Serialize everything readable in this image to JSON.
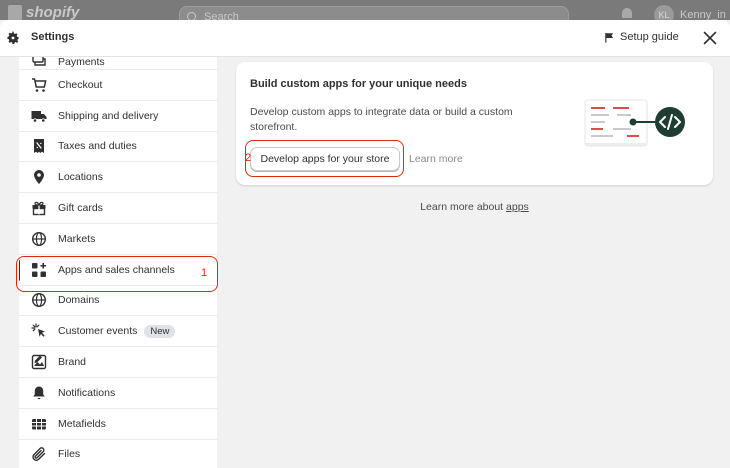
{
  "admin_bar": {
    "logo_text": "shopify",
    "search_placeholder": "Search",
    "user_initials": "KL",
    "user_name": "Kenny_in"
  },
  "header": {
    "title": "Settings",
    "setup_guide": "Setup guide"
  },
  "sidebar": {
    "items": [
      {
        "label": "Payments",
        "icon": "payments-icon"
      },
      {
        "label": "Checkout",
        "icon": "cart-icon"
      },
      {
        "label": "Shipping and delivery",
        "icon": "truck-icon"
      },
      {
        "label": "Taxes and duties",
        "icon": "receipt-icon"
      },
      {
        "label": "Locations",
        "icon": "location-pin-icon"
      },
      {
        "label": "Gift cards",
        "icon": "gift-icon"
      },
      {
        "label": "Markets",
        "icon": "globe-icon"
      },
      {
        "label": "Apps and sales channels",
        "icon": "apps-icon"
      },
      {
        "label": "Domains",
        "icon": "globe-icon"
      },
      {
        "label": "Customer events",
        "icon": "cursor-icon",
        "badge": "New"
      },
      {
        "label": "Brand",
        "icon": "brand-icon"
      },
      {
        "label": "Notifications",
        "icon": "bell-icon"
      },
      {
        "label": "Metafields",
        "icon": "metafields-icon"
      },
      {
        "label": "Files",
        "icon": "paperclip-icon"
      }
    ]
  },
  "main": {
    "card_title": "Build custom apps for your unique needs",
    "card_description": "Develop custom apps to integrate data or build a custom storefront.",
    "develop_button": "Develop apps for your store",
    "learn_more": "Learn more",
    "footer_prefix": "Learn more about",
    "footer_link": "apps"
  },
  "annotations": {
    "step1": "1",
    "step2": "2"
  },
  "colors": {
    "annotation_red": "#d72c0d",
    "accent_dark": "#303030",
    "illustration_red": "#e04b4b",
    "illustration_dark": "#1f3d33"
  }
}
